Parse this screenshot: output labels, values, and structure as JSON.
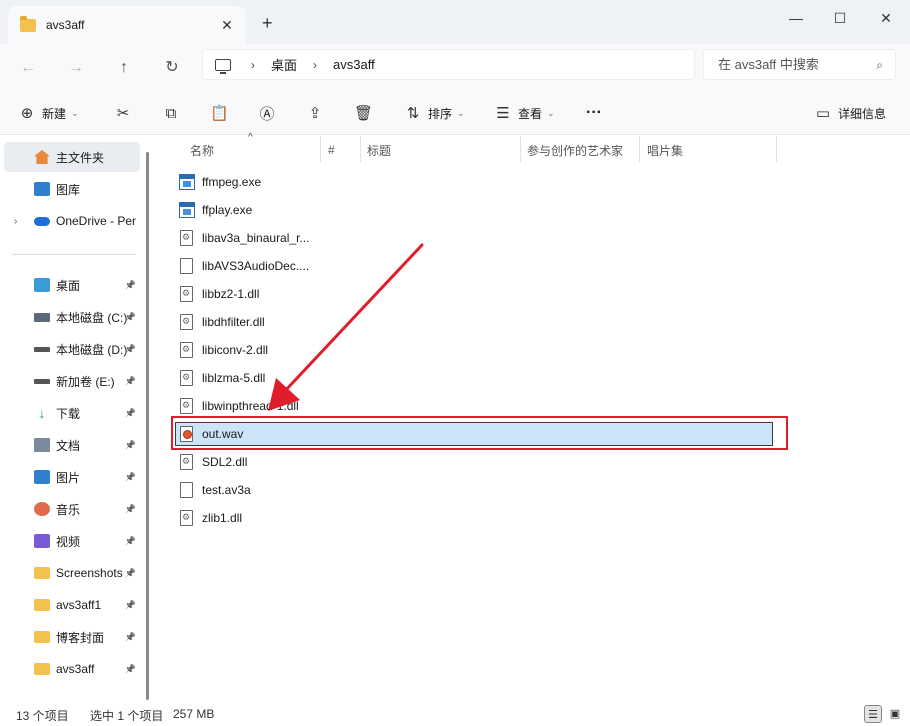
{
  "window": {
    "tab_title": "avs3aff",
    "new_tab": "+",
    "tab_close": "✕",
    "minimize": "—",
    "maximize": "☐",
    "close": "✕"
  },
  "address": {
    "breadcrumb": [
      "桌面",
      "avs3aff"
    ],
    "search_placeholder": "在 avs3aff 中搜索"
  },
  "toolbar": {
    "new_label": "新建",
    "sort_label": "排序",
    "view_label": "查看",
    "more_label": "···",
    "details_label": "详细信息"
  },
  "sidebar": {
    "items": [
      {
        "label": "主文件夹",
        "icon": "home-icon",
        "pinned": false,
        "selected": true
      },
      {
        "label": "图库",
        "icon": "gallery-icon",
        "pinned": false
      },
      {
        "label": "OneDrive - Per",
        "icon": "cloud-icon",
        "pinned": false,
        "expandable": true
      },
      {
        "label": "桌面",
        "icon": "desktop-icon",
        "pinned": true
      },
      {
        "label": "本地磁盘 (C:)",
        "icon": "drive-c-icon",
        "pinned": true
      },
      {
        "label": "本地磁盘 (D:)",
        "icon": "drive-icon",
        "pinned": true
      },
      {
        "label": "新加卷 (E:)",
        "icon": "drive-icon",
        "pinned": true
      },
      {
        "label": "下载",
        "icon": "download-icon",
        "pinned": true
      },
      {
        "label": "文档",
        "icon": "documents-icon",
        "pinned": true
      },
      {
        "label": "图片",
        "icon": "pictures-icon",
        "pinned": true
      },
      {
        "label": "音乐",
        "icon": "music-icon",
        "pinned": true
      },
      {
        "label": "视频",
        "icon": "video-icon",
        "pinned": true
      },
      {
        "label": "Screenshots",
        "icon": "folder-icon",
        "pinned": true
      },
      {
        "label": "avs3aff1",
        "icon": "folder-icon",
        "pinned": true
      },
      {
        "label": "博客封面",
        "icon": "folder-icon",
        "pinned": true
      },
      {
        "label": "avs3aff",
        "icon": "folder-icon",
        "pinned": true
      }
    ]
  },
  "columns": [
    "名称",
    "#",
    "标题",
    "参与创作的艺术家",
    "唱片集"
  ],
  "files": [
    {
      "name": "ffmpeg.exe",
      "type": "exe"
    },
    {
      "name": "ffplay.exe",
      "type": "exe"
    },
    {
      "name": "libav3a_binaural_r...",
      "type": "dll"
    },
    {
      "name": "libAVS3AudioDec....",
      "type": "blank"
    },
    {
      "name": "libbz2-1.dll",
      "type": "dll"
    },
    {
      "name": "libdhfilter.dll",
      "type": "dll"
    },
    {
      "name": "libiconv-2.dll",
      "type": "dll"
    },
    {
      "name": "liblzma-5.dll",
      "type": "dll"
    },
    {
      "name": "libwinpthread-1.dll",
      "type": "dll"
    },
    {
      "name": "out.wav",
      "type": "wav",
      "selected": true
    },
    {
      "name": "SDL2.dll",
      "type": "dll"
    },
    {
      "name": "test.av3a",
      "type": "blank"
    },
    {
      "name": "zlib1.dll",
      "type": "dll"
    }
  ],
  "status": {
    "item_count": "13 个项目",
    "selection": "选中 1 个项目",
    "size": "257 MB"
  },
  "colors": {
    "annotation_red": "#e01e2b",
    "selection_bg": "#cce4f7"
  }
}
